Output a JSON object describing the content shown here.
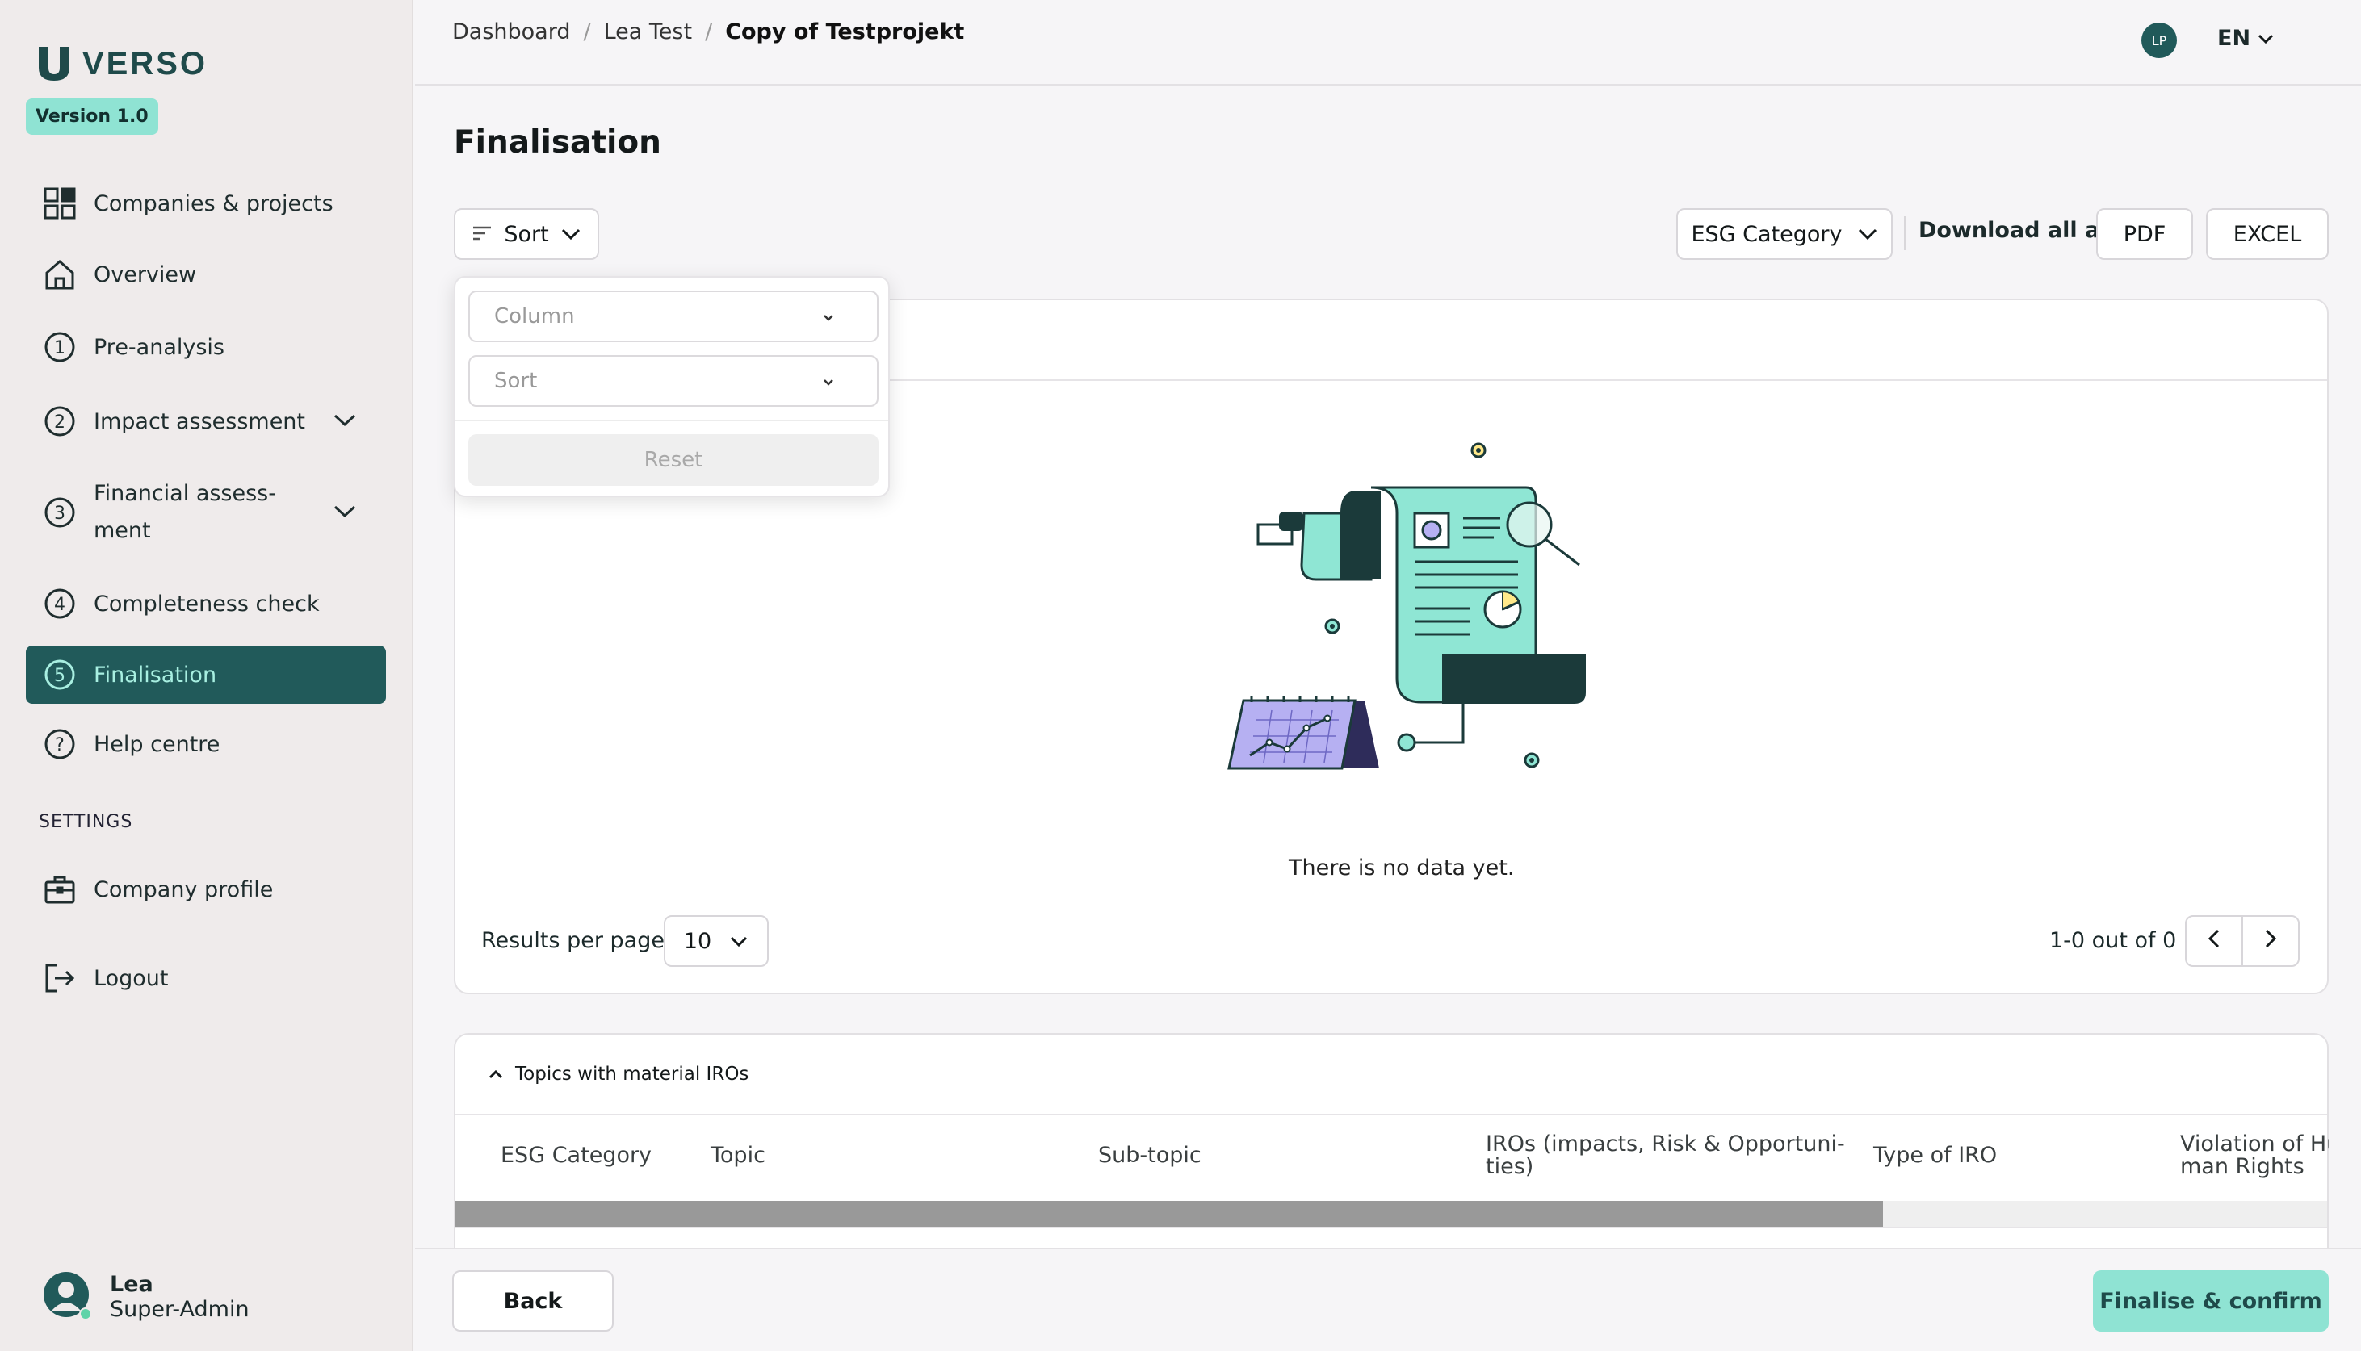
{
  "app": {
    "name": "VERSO",
    "version": "Version 1.0"
  },
  "sidebar": {
    "items": [
      {
        "label": "Companies & projects"
      },
      {
        "label": "Overview"
      },
      {
        "label": "Pre-analysis"
      },
      {
        "label": "Impact assessment"
      },
      {
        "label_line1": "Financial assess-",
        "label_line2": "ment"
      },
      {
        "label": "Completeness check"
      },
      {
        "label": "Finalisation"
      },
      {
        "label": "Help centre"
      }
    ],
    "settings_heading": "SETTINGS",
    "settings_items": [
      {
        "label": "Company profile"
      }
    ],
    "logout": "Logout",
    "user": {
      "name": "Lea",
      "role": "Super-Admin"
    }
  },
  "header": {
    "breadcrumb": [
      "Dashboard",
      "Lea Test",
      "Copy of Testprojekt"
    ],
    "separator": "/",
    "avatar_initials": "LP",
    "language": "EN"
  },
  "page": {
    "title": "Finalisation",
    "sort_button": "Sort",
    "category_select": "ESG Category",
    "download_label": "Download all as",
    "pdf_button": "PDF",
    "excel_button": "EXCEL"
  },
  "sort_dropdown": {
    "column_placeholder": "Column",
    "sort_placeholder": "Sort",
    "reset_button": "Reset"
  },
  "empty_state": {
    "message": "There is no data yet."
  },
  "pagination": {
    "results_label": "Results per page",
    "per_page": "10",
    "range": "1-0 out of 0"
  },
  "material_topics": {
    "title": "Topics with material IROs",
    "columns": [
      "ESG Category",
      "Topic",
      "Sub-topic",
      "IROs (impacts, Risk & Opportuni-",
      "ties)",
      "Type of IRO",
      "Violation of Hu",
      "man Rights"
    ]
  },
  "footer": {
    "back_button": "Back",
    "confirm_button": "Finalise & confirm"
  },
  "colors": {
    "accent": "#215a5a",
    "accent_light": "#8fe3d3",
    "illustration_mint": "#8fe6d4",
    "illustration_lilac": "#b6b0f2"
  }
}
